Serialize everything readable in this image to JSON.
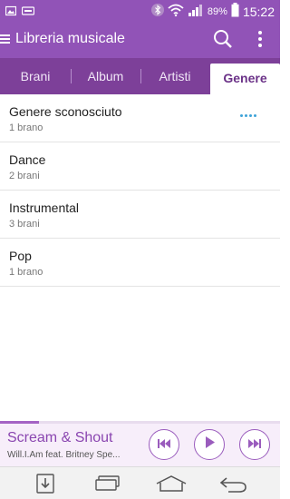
{
  "status_bar": {
    "battery": "89%",
    "time": "15:22"
  },
  "app_bar": {
    "title": "Libreria musicale"
  },
  "tabs": [
    {
      "label": "Brani",
      "active": false
    },
    {
      "label": "Album",
      "active": false
    },
    {
      "label": "Artisti",
      "active": false
    },
    {
      "label": "Genere",
      "active": true
    }
  ],
  "genres": [
    {
      "name": "Genere sconosciuto",
      "count": "1 brano"
    },
    {
      "name": "Dance",
      "count": "2 brani"
    },
    {
      "name": "Instrumental",
      "count": "3 brani"
    },
    {
      "name": "Pop",
      "count": "1 brano"
    }
  ],
  "player": {
    "song": "Scream & Shout",
    "artist": "Will.I.Am feat. Britney Spe...",
    "progress": 0.14
  },
  "colors": {
    "accent": "#9153b7",
    "tab_bar": "#7d4099",
    "link_dots": "#3ea3d8"
  }
}
